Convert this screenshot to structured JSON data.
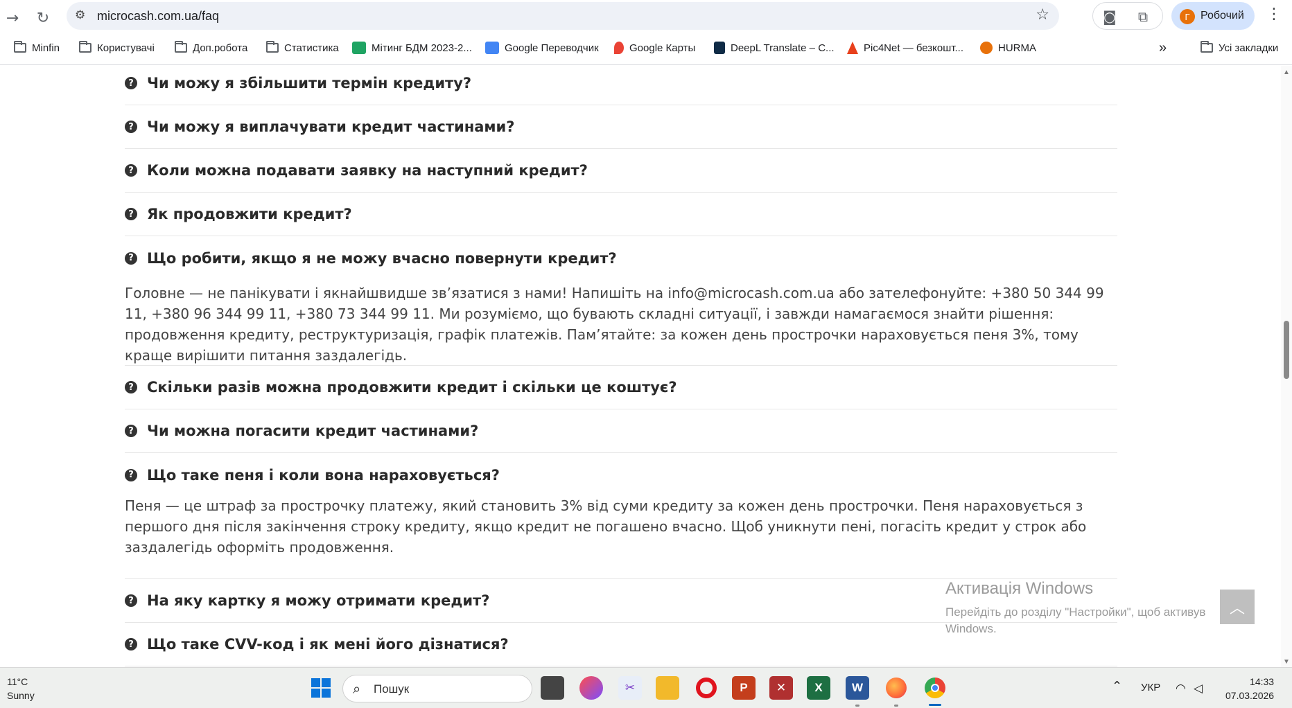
{
  "browser": {
    "url": "microcash.com.ua/faq",
    "profile_initial": "Г",
    "profile_name": "Робочий",
    "bookmarks": [
      {
        "label": "Minfin",
        "icon": "folder-icon"
      },
      {
        "label": "Користувачі",
        "icon": "folder-icon"
      },
      {
        "label": "Доп.робота",
        "icon": "folder-icon"
      },
      {
        "label": "Статистика",
        "icon": "folder-icon"
      },
      {
        "label": "Мітинг БДМ 2023-2...",
        "icon": "sheets-icon"
      },
      {
        "label": "Google Переводчик",
        "icon": "translate-icon"
      },
      {
        "label": "Google Карты",
        "icon": "maps-icon"
      },
      {
        "label": "DeepL Translate – C...",
        "icon": "deepl-icon"
      },
      {
        "label": "Pic4Net — безкошт...",
        "icon": "pic4net-icon"
      },
      {
        "label": "HURMA",
        "icon": "hurma-icon"
      }
    ],
    "all_bookmarks": "Усі закладки"
  },
  "faq": {
    "items": [
      {
        "question": "Чи можу я збільшити термін кредиту?"
      },
      {
        "question": "Чи можу я виплачувати кредит частинами?"
      },
      {
        "question": "Коли можна подавати заявку на наступний кредит?"
      },
      {
        "question": "Як продовжити кредит?"
      },
      {
        "question": "Що робити, якщо я не можу вчасно повернути кредит?",
        "answer": "Головне — не панікувати і якнайшвидше зв’язатися з нами! Напишіть на info@microcash.com.ua або зателефонуйте: +380 50 344 99 11, +380 96 344 99 11, +380 73 344 99 11. Ми розуміємо, що бувають складні ситуації, і завжди намагаємося знайти рішення: продовження кредиту, реструктуризація, графік платежів. Пам’ятайте: за кожен день прострочки нараховується пеня 3%, тому краще вирішити питання заздалегідь."
      },
      {
        "question": "Скільки разів можна продовжити кредит і скільки це коштує?"
      },
      {
        "question": "Чи можна погасити кредит частинами?"
      },
      {
        "question": "Що таке пеня і коли вона нараховується?",
        "answer": "Пеня — це штраф за прострочку платежу, який становить 3% від суми кредиту за кожен день прострочки. Пеня нараховується з першого дня після закінчення строку кредиту, якщо кредит не погашено вчасно. Щоб уникнути пені, погасіть кредит у строк або заздалегідь оформіть продовження."
      },
      {
        "question": "На яку картку я можу отримати кредит?"
      },
      {
        "question": "Що таке CVV-код і як мені його дізнатися?"
      }
    ]
  },
  "overlay": {
    "activation_title": "Активація Windows",
    "activation_line1": "Перейдіть до розділу \"Настройки\", щоб активув",
    "activation_line2": "Windows."
  },
  "taskbar": {
    "temperature": "11°C",
    "weather": "Sunny",
    "search_placeholder": "Пошук",
    "language": "УКР",
    "time": "14:33",
    "date": "07.03.2026"
  }
}
